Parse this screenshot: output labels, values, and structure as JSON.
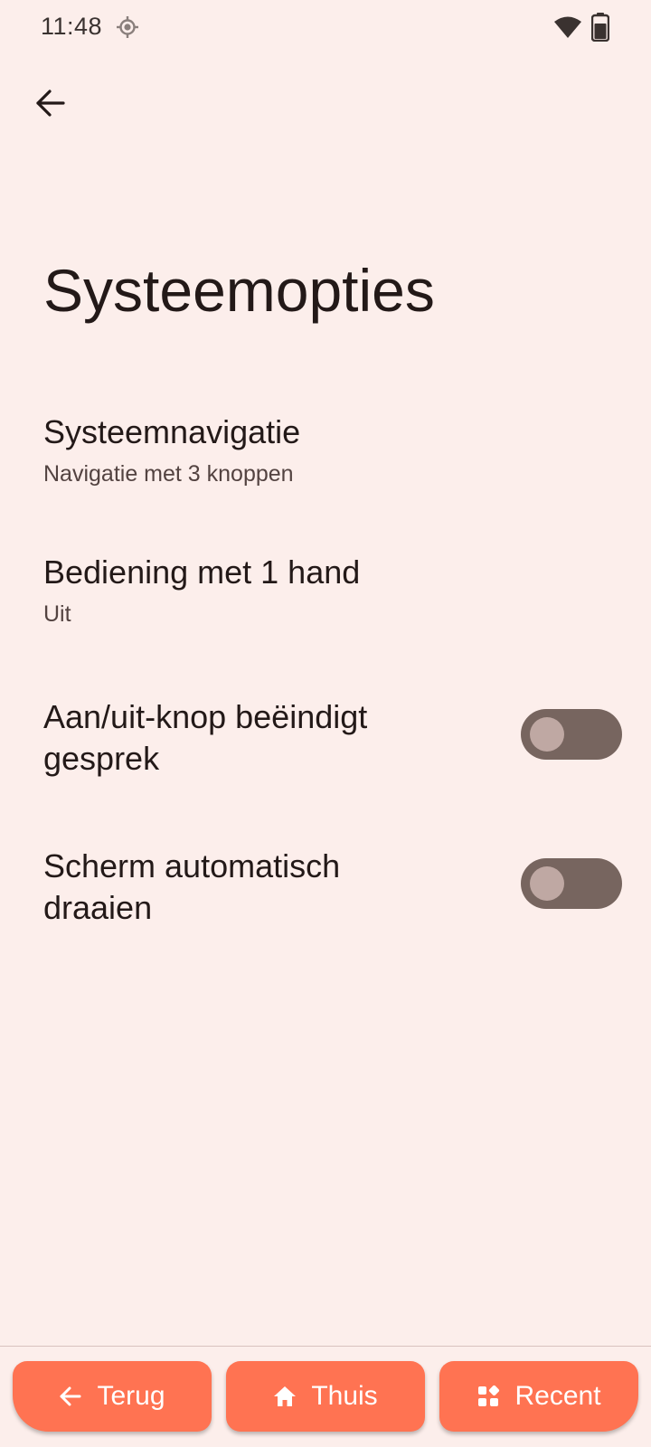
{
  "status_bar": {
    "time": "11:48",
    "icons": [
      "location-icon",
      "wifi-icon",
      "battery-icon"
    ]
  },
  "header": {
    "back_icon": "arrow-left-icon"
  },
  "page": {
    "title": "Systeemopties"
  },
  "settings": [
    {
      "title": "Systeemnavigatie",
      "summary": "Navigatie met 3 knoppen"
    },
    {
      "title": "Bediening met 1 hand",
      "summary": "Uit"
    },
    {
      "title": "Aan/uit-knop beëindigt gesprek",
      "toggle_on": false
    },
    {
      "title": "Scherm automatisch draaien",
      "toggle_on": false
    }
  ],
  "nav_bar": {
    "back_label": "Terug",
    "home_label": "Thuis",
    "recent_label": "Recent",
    "accent_color": "#FF7352"
  },
  "colors": {
    "background": "#FCEEEB",
    "toggle_track_off": "#77655F",
    "toggle_thumb_off": "#BFA8A3"
  }
}
